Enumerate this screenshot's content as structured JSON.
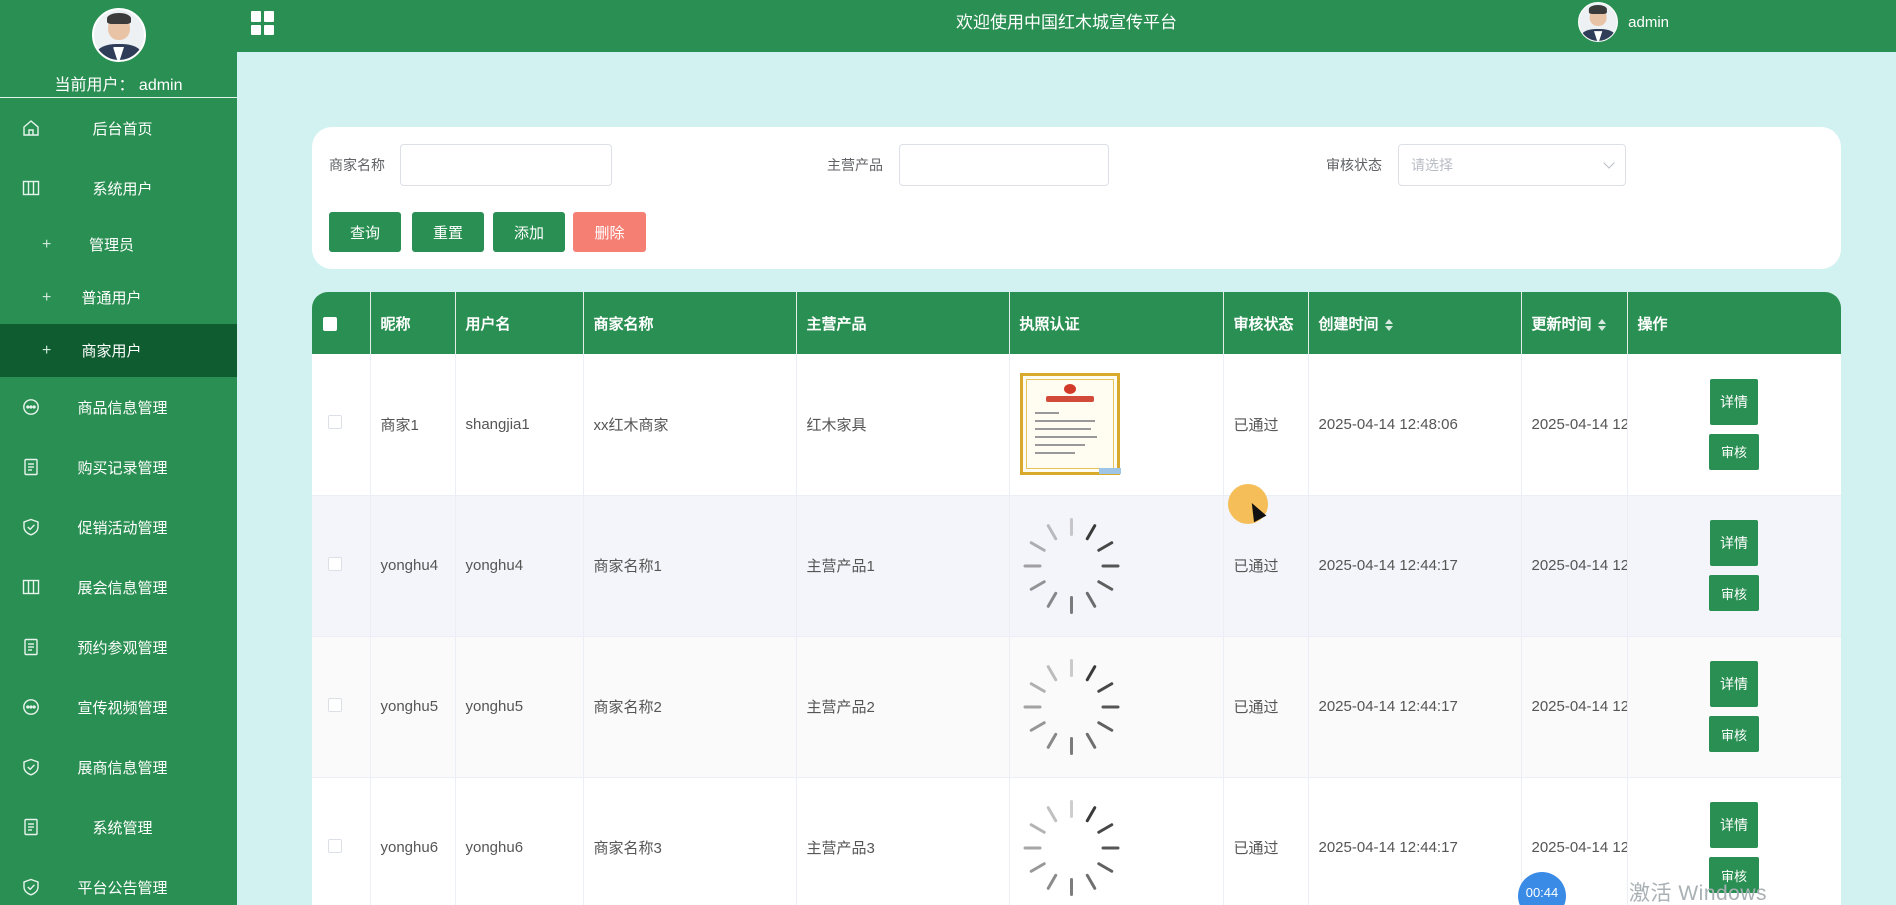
{
  "header": {
    "title": "欢迎使用中国红木城宣传平台",
    "username": "admin"
  },
  "sidebar": {
    "current_user": "当前用户：  admin",
    "items": [
      {
        "label": "后台首页",
        "icon": "home-icon"
      },
      {
        "label": "系统用户",
        "icon": "table-icon"
      },
      {
        "label": "管理员",
        "sub": true
      },
      {
        "label": "普通用户",
        "sub": true
      },
      {
        "label": "商家用户",
        "sub": true,
        "active": true
      },
      {
        "label": "商品信息管理",
        "icon": "chat-icon"
      },
      {
        "label": "购买记录管理",
        "icon": "document-icon"
      },
      {
        "label": "促销活动管理",
        "icon": "shield-check-icon"
      },
      {
        "label": "展会信息管理",
        "icon": "table-icon"
      },
      {
        "label": "预约参观管理",
        "icon": "document-icon"
      },
      {
        "label": "宣传视频管理",
        "icon": "chat-icon"
      },
      {
        "label": "展商信息管理",
        "icon": "shield-check-icon"
      },
      {
        "label": "系统管理",
        "icon": "document-icon"
      },
      {
        "label": "平台公告管理",
        "icon": "shield-check-icon"
      }
    ]
  },
  "search": {
    "merchant_label": "商家名称",
    "merchant_value": "",
    "product_label": "主营产品",
    "product_value": "",
    "status_label": "审核状态",
    "status_placeholder": "请选择",
    "buttons": {
      "query": "查询",
      "reset": "重置",
      "add": "添加",
      "delete": "删除"
    }
  },
  "table": {
    "columns": [
      "昵称",
      "用户名",
      "商家名称",
      "主营产品",
      "执照认证",
      "审核状态",
      "创建时间",
      "更新时间",
      "操作"
    ],
    "rows": [
      {
        "nickname": "商家1",
        "username": "shangjia1",
        "merchant": "xx红木商家",
        "product": "红木家具",
        "license": "image",
        "status": "已通过",
        "created": "2025-04-14 12:48:06",
        "updated": "2025-04-14 12"
      },
      {
        "nickname": "yonghu4",
        "username": "yonghu4",
        "merchant": "商家名称1",
        "product": "主营产品1",
        "license": "loading",
        "status": "已通过",
        "created": "2025-04-14 12:44:17",
        "updated": "2025-04-14 12"
      },
      {
        "nickname": "yonghu5",
        "username": "yonghu5",
        "merchant": "商家名称2",
        "product": "主营产品2",
        "license": "loading",
        "status": "已通过",
        "created": "2025-04-14 12:44:17",
        "updated": "2025-04-14 12"
      },
      {
        "nickname": "yonghu6",
        "username": "yonghu6",
        "merchant": "商家名称3",
        "product": "主营产品3",
        "license": "loading",
        "status": "已通过",
        "created": "2025-04-14 12:44:17",
        "updated": "2025-04-14 12"
      }
    ],
    "detail_label": "详情",
    "audit_label": "审核"
  },
  "overlay": {
    "timer": "00:44",
    "watermark": "激活 Windows"
  },
  "colors": {
    "primary": "#2a8f52",
    "active_menu": "#0f5c30",
    "background": "#d1f2f0",
    "danger": "#f67f74"
  }
}
